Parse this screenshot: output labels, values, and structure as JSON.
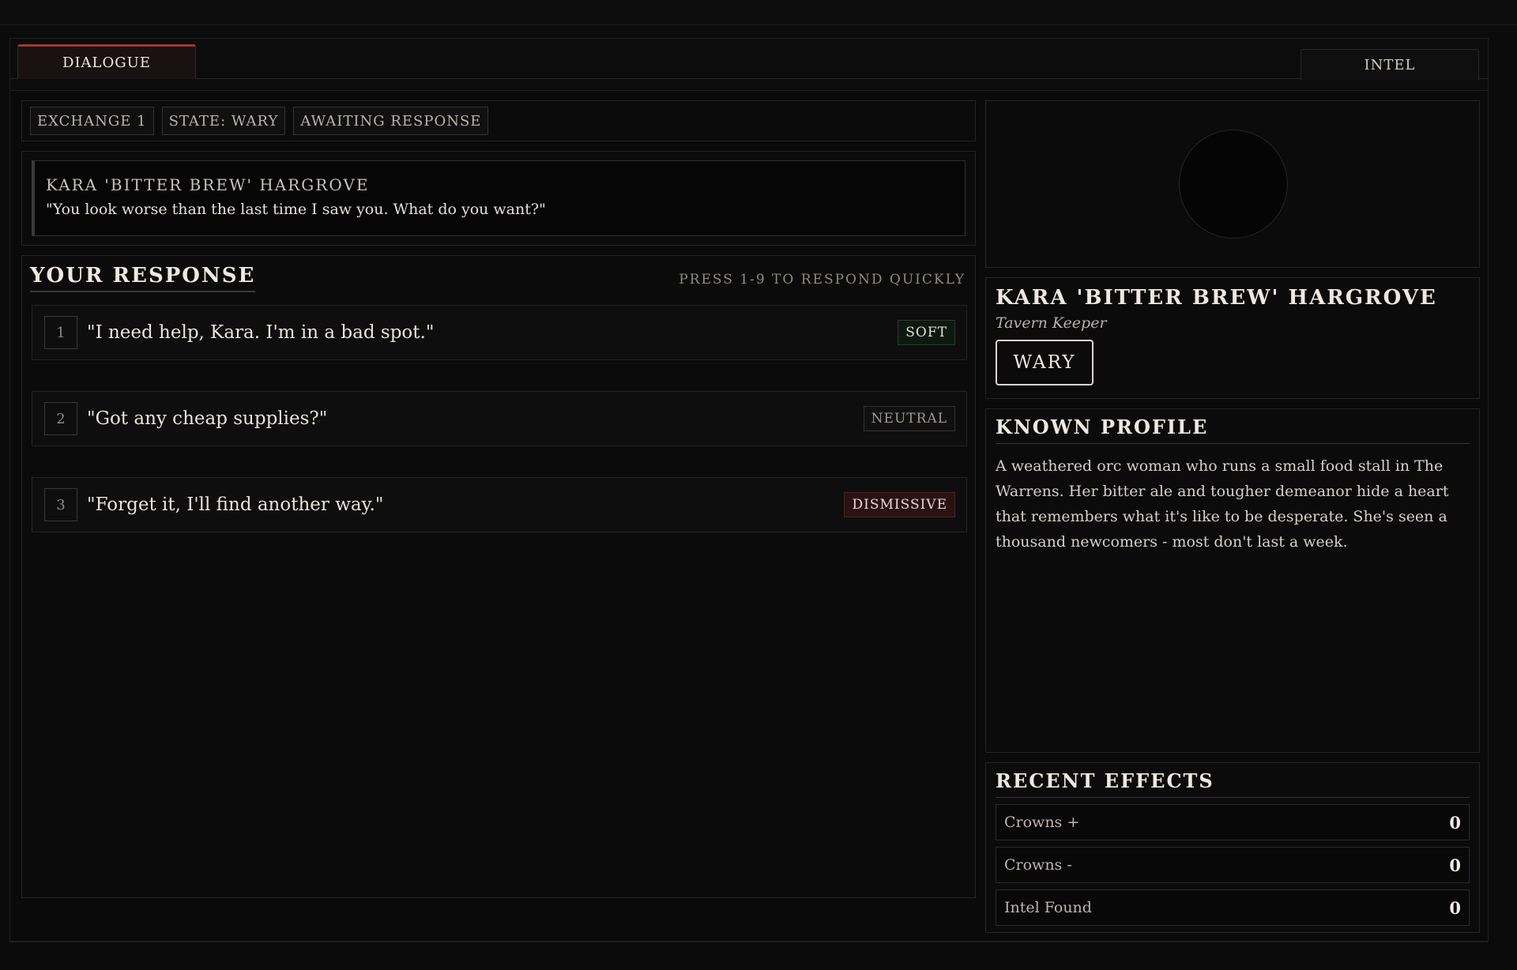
{
  "tabs": {
    "dialogue": "DIALOGUE",
    "intel": "INTEL"
  },
  "status": {
    "exchange": "EXCHANGE 1",
    "state": "STATE: WARY",
    "awaiting": "AWAITING RESPONSE"
  },
  "speech": {
    "speaker": "KARA 'BITTER BREW' HARGROVE",
    "line": "\"You look worse than the last time I saw you. What do you want?\""
  },
  "response": {
    "title": "YOUR RESPONSE",
    "hint": "PRESS 1-9 TO RESPOND QUICKLY",
    "options": [
      {
        "num": "1",
        "text": "\"I need help, Kara. I'm in a bad spot.\"",
        "tone": "SOFT"
      },
      {
        "num": "2",
        "text": "\"Got any cheap supplies?\"",
        "tone": "NEUTRAL"
      },
      {
        "num": "3",
        "text": "\"Forget it, I'll find another way.\"",
        "tone": "DISMISSIVE"
      }
    ]
  },
  "character": {
    "name": "KARA 'BITTER BREW' HARGROVE",
    "role": "Tavern Keeper",
    "mood": "WARY"
  },
  "profile": {
    "title": "KNOWN PROFILE",
    "text": "A weathered orc woman who runs a small food stall in The Warrens. Her bitter ale and tougher demeanor hide a heart that remembers what it's like to be desperate. She's seen a thousand newcomers - most don't last a week."
  },
  "effects": {
    "title": "RECENT EFFECTS",
    "items": [
      {
        "label": "Crowns +",
        "value": "0"
      },
      {
        "label": "Crowns -",
        "value": "0"
      },
      {
        "label": "Intel Found",
        "value": "0"
      }
    ]
  }
}
